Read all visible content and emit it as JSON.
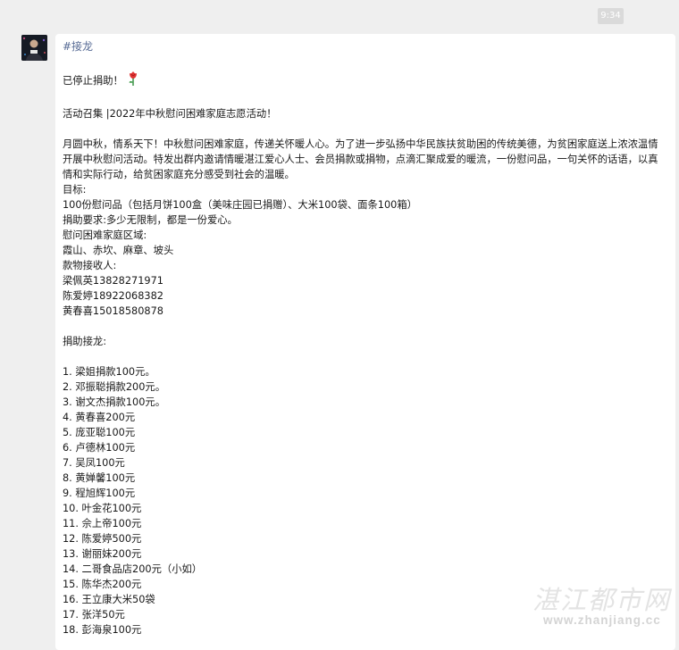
{
  "time": "9:34",
  "tag": "#接龙",
  "status": "已停止捐助！",
  "status_icon": "rose-icon",
  "campaign": "活动召集 |2022年中秋慰问困难家庭志愿活动！",
  "intro": "月圆中秋，情系天下！中秋慰问困难家庭，传递关怀暖人心。为了进一步弘扬中华民族扶贫助困的传统美德，为贫困家庭送上浓浓温情开展中秋慰问活动。特发出群内邀请情暖湛江爱心人士、会员捐款或捐物，点滴汇聚成爱的暖流，一份慰问品，一句关怀的话语，以真情和实际行动，给贫困家庭充分感受到社会的温暖。",
  "details": [
    "目标:",
    "100份慰问品（包括月饼100盒（美味庄园已捐赠）、大米100袋、面条100箱）",
    "捐助要求:多少无限制，都是一份爱心。",
    "慰问困难家庭区域:",
    "霞山、赤坎、麻章、坡头",
    "款物接收人:",
    "梁佩英13828271971",
    "陈爱婷18922068382",
    "黄春喜15018580878"
  ],
  "donation_heading": "捐助接龙:",
  "donations": [
    "1. 梁姐捐款100元。",
    "2. 邓振聪捐款200元。",
    "3. 谢文杰捐款100元。",
    "4. 黄春喜200元",
    "5. 庞亚聪100元",
    "6. 卢德林100元",
    "7. 吴凤100元",
    "8. 黄婵馨100元",
    "9. 程旭辉100元",
    "10. 叶金花100元",
    "11. 佘上帝100元",
    "12. 陈爱婷500元",
    "13. 谢丽妹200元",
    "14. 二哥食品店200元（小如）",
    "15. 陈华杰200元",
    "16. 王立康大米50袋",
    "17. 张洋50元",
    "18. 彭海泉100元"
  ],
  "watermark": {
    "cn": "湛江都市网",
    "url": "www.zhanjiang.cc"
  }
}
